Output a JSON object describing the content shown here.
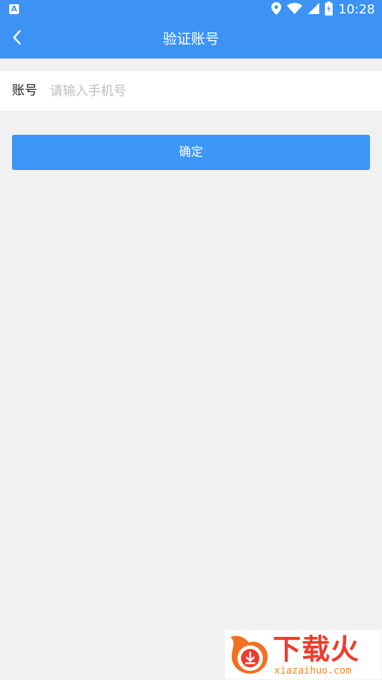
{
  "status_bar": {
    "left_icon_glyph": "A",
    "time": "10:28",
    "icons": [
      "location-pin-icon",
      "wifi-icon",
      "signal-icon",
      "battery-icon"
    ]
  },
  "app_bar": {
    "title": "验证账号",
    "back_icon": "chevron-left-icon"
  },
  "form": {
    "account_label": "账号",
    "account_placeholder": "请输入手机号",
    "account_value": ""
  },
  "actions": {
    "confirm_label": "确定"
  },
  "watermark": {
    "brand": "下载火",
    "domain": "xiazaihuo.com"
  },
  "colors": {
    "primary": "#3c93f4",
    "button": "#3c97f7",
    "background": "#f1f1f1",
    "placeholder": "#bdbdbd",
    "brand_red": "#ef3b2d",
    "brand_orange": "#f08a2a"
  }
}
